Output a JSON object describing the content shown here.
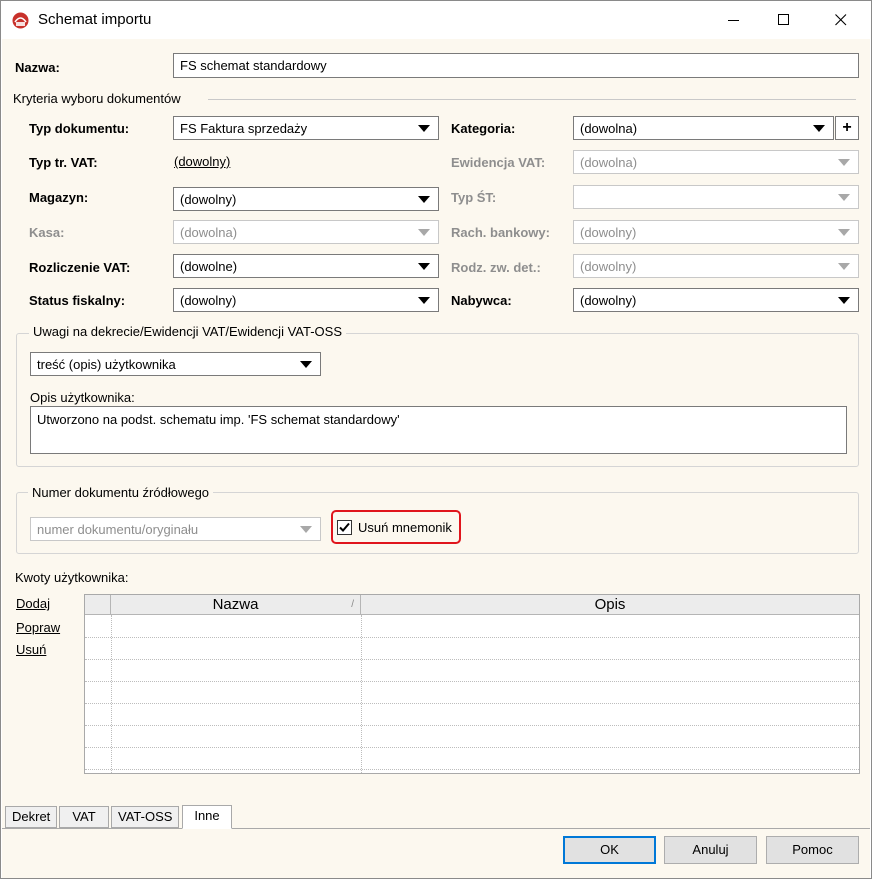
{
  "window": {
    "title": "Schemat importu"
  },
  "name_field": {
    "label": "Nazwa:",
    "value": "FS schemat standardowy"
  },
  "criteria": {
    "title": "Kryteria wyboru dokumentów",
    "typ_dokumentu": {
      "label": "Typ dokumentu:",
      "value": "FS Faktura sprzedaży"
    },
    "kategoria": {
      "label": "Kategoria:",
      "value": "(dowolna)",
      "add": "+"
    },
    "typ_tr_vat": {
      "label": "Typ tr. VAT:",
      "value": "(dowolny)"
    },
    "ewidencja_vat": {
      "label": "Ewidencja VAT:",
      "value": "(dowolna)"
    },
    "magazyn": {
      "label": "Magazyn:",
      "value": "(dowolny)"
    },
    "typ_st": {
      "label": "Typ ŚT:",
      "value": ""
    },
    "kasa": {
      "label": "Kasa:",
      "value": "(dowolna)"
    },
    "rach_bankowy": {
      "label": "Rach. bankowy:",
      "value": "(dowolny)"
    },
    "rozliczenie_vat": {
      "label": "Rozliczenie VAT:",
      "value": "(dowolne)"
    },
    "rodz_zw_det": {
      "label": "Rodz. zw. det.:",
      "value": "(dowolny)"
    },
    "status_fiskalny": {
      "label": "Status fiskalny:",
      "value": "(dowolny)"
    },
    "nabywca": {
      "label": "Nabywca:",
      "value": "(dowolny)"
    }
  },
  "uwagi": {
    "title": "Uwagi na dekrecie/Ewidencji VAT/Ewidencji VAT-OSS",
    "source_value": "treść (opis) użytkownika",
    "opis_label": "Opis użytkownika:",
    "opis_value": "Utworzono na podst. schematu imp. 'FS schemat standardowy'"
  },
  "numer": {
    "title": "Numer dokumentu źródłowego",
    "value": "numer dokumentu/oryginału",
    "checkbox_label": "Usuń mnemonik",
    "checked": true
  },
  "kwoty": {
    "title": "Kwoty użytkownika:",
    "actions": {
      "add": "Dodaj",
      "edit": "Popraw",
      "delete": "Usuń"
    },
    "columns": [
      "Nazwa",
      "Opis"
    ],
    "sort_indicator": "/"
  },
  "tabs": [
    "Dekret",
    "VAT",
    "VAT-OSS",
    "Inne"
  ],
  "active_tab": "Inne",
  "buttons": {
    "ok": "OK",
    "cancel": "Anuluj",
    "help": "Pomoc"
  },
  "colors": {
    "highlight": "#e0151c",
    "background": "#fcf8ef",
    "default_button_border": "#0078d7"
  }
}
